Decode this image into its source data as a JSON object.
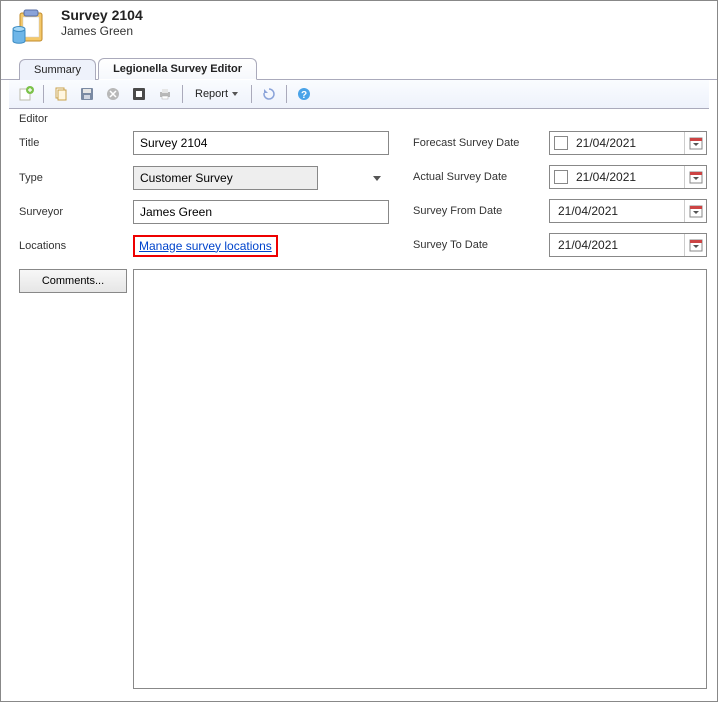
{
  "header": {
    "title": "Survey 2104",
    "subtitle": "James Green"
  },
  "tabs": [
    {
      "label": "Summary",
      "active": false
    },
    {
      "label": "Legionella Survey Editor",
      "active": true
    }
  ],
  "toolbar": {
    "report_label": "Report"
  },
  "editor": {
    "section_label": "Editor",
    "labels": {
      "title": "Title",
      "type": "Type",
      "surveyor": "Surveyor",
      "locations": "Locations",
      "forecast": "Forecast Survey Date",
      "actual": "Actual Survey Date",
      "from": "Survey From Date",
      "to": "Survey To Date",
      "comments": "Comments..."
    },
    "values": {
      "title": "Survey 2104",
      "type": "Customer Survey",
      "surveyor": "James Green",
      "locations_link": "Manage survey locations",
      "forecast_date": "21/04/2021",
      "actual_date": "21/04/2021",
      "from_date": "21/04/2021",
      "to_date": "21/04/2021",
      "comments": ""
    },
    "date_checkboxes": {
      "forecast": false,
      "actual": false
    }
  }
}
